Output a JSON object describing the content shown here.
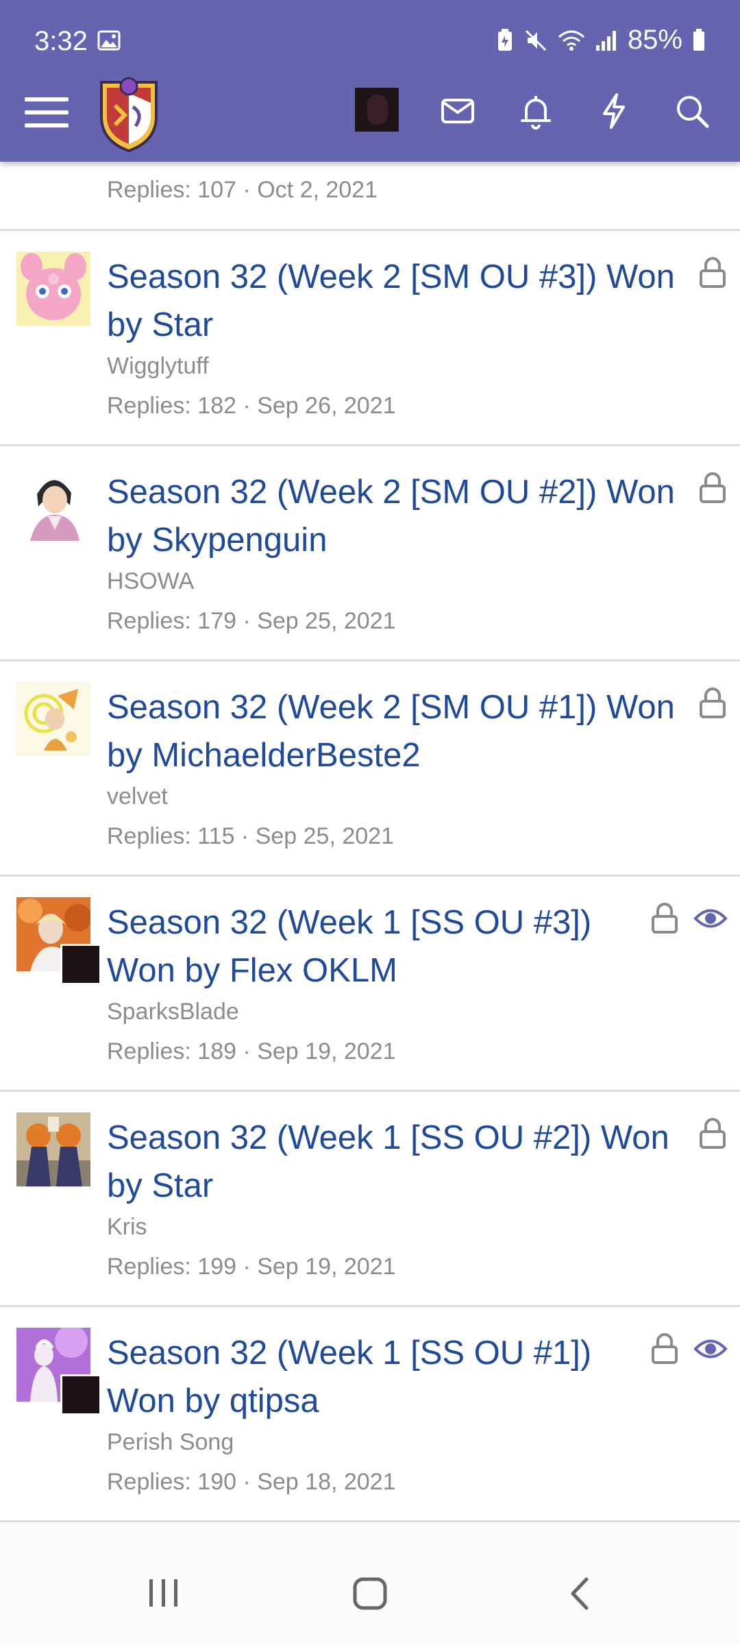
{
  "status_bar": {
    "time": "3:32",
    "battery": "85%"
  },
  "header": {
    "menu_icon": "hamburger-menu-icon",
    "logo_icon": "forum-logo-icon",
    "icons": [
      "mail-icon",
      "bell-icon",
      "lightning-icon",
      "search-icon"
    ],
    "bg_color": "#6464b0"
  },
  "partial_thread": {
    "meta": "Replies: 107 · Oct 2, 2021"
  },
  "threads": [
    {
      "title": "Season 32 (Week 2 [SM OU #3]) Won by Star",
      "author": "Wigglytuff",
      "meta": "Replies: 182 · Sep 26, 2021",
      "locked": true,
      "watched": false
    },
    {
      "title": "Season 32 (Week 2 [SM OU #2]) Won by Skypenguin",
      "author": "HSOWA",
      "meta": "Replies: 179 · Sep 25, 2021",
      "locked": true,
      "watched": false
    },
    {
      "title": "Season 32 (Week 2 [SM OU #1]) Won by MichaelderBeste2",
      "author": "velvet",
      "meta": "Replies: 115 · Sep 25, 2021",
      "locked": true,
      "watched": false
    },
    {
      "title": "Season 32 (Week 1 [SS OU #3]) Won by Flex OKLM",
      "author": "SparksBlade",
      "meta": "Replies: 189 · Sep 19, 2021",
      "locked": true,
      "watched": true
    },
    {
      "title": "Season 32 (Week 1 [SS OU #2]) Won by Star",
      "author": "Kris",
      "meta": "Replies: 199 · Sep 19, 2021",
      "locked": true,
      "watched": false
    },
    {
      "title": "Season 32 (Week 1 [SS OU #1]) Won by qtipsa",
      "author": "Perish Song",
      "meta": "Replies: 190 · Sep 18, 2021",
      "locked": true,
      "watched": true
    }
  ],
  "colors": {
    "title": "#1f4a9c",
    "meta": "#8c8c8c",
    "icon": "#8a8a8a",
    "watch_icon": "#6464b0"
  }
}
